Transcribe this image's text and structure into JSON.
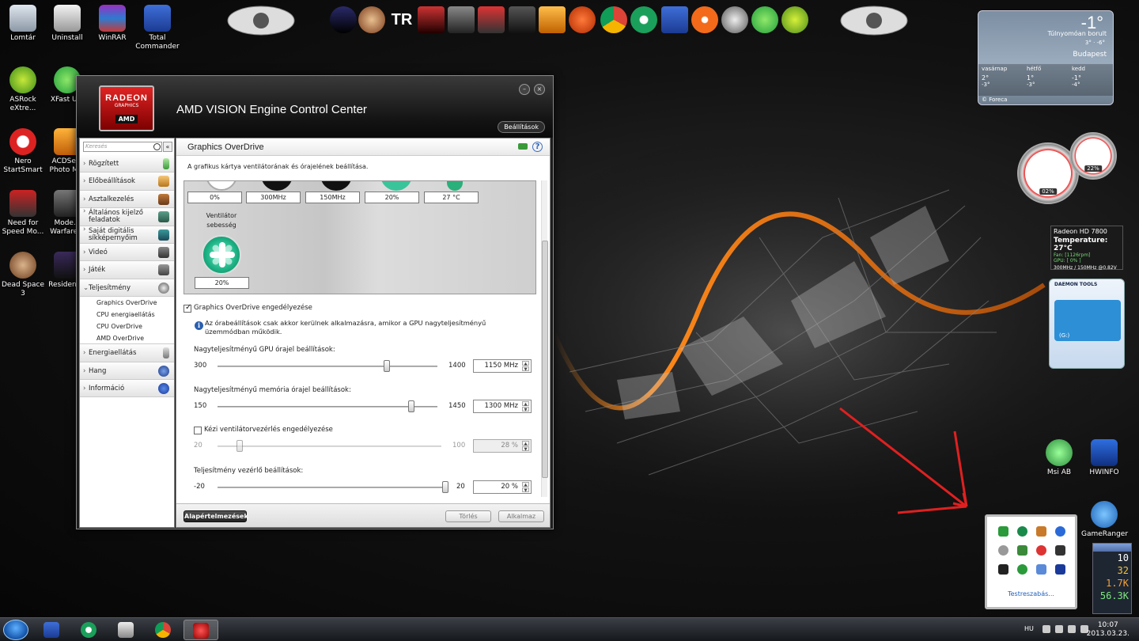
{
  "desktop": {
    "icons": [
      {
        "label": "Lomtár"
      },
      {
        "label": "Uninstall"
      },
      {
        "label": "WinRAR"
      },
      {
        "label": "Total Commander"
      },
      {
        "label": "ASRock eXtre..."
      },
      {
        "label": "XFast U..."
      },
      {
        "label": "Nero StartSmart"
      },
      {
        "label": "ACDSe... Photo M..."
      },
      {
        "label": "Need for Speed Mo..."
      },
      {
        "label": "Mode... Warfare..."
      },
      {
        "label": "Dead Space 3"
      },
      {
        "label": "Resident..."
      },
      {
        "label": "Msi AB"
      },
      {
        "label": "HWINFO"
      },
      {
        "label": "GameRanger"
      }
    ]
  },
  "dock": {
    "label_tr": "TR"
  },
  "weather": {
    "temperature": "-1°",
    "condition": "Túlnyomóan borult",
    "minmax": "3° · -6°",
    "city": "Budapest",
    "days": [
      {
        "name": "vasárnap",
        "hi": "2°",
        "lo": "-3°"
      },
      {
        "name": "hétfő",
        "hi": "1°",
        "lo": "-3°"
      },
      {
        "name": "kedd",
        "hi": "-1°",
        "lo": "-4°"
      }
    ],
    "brand": "© Foreca"
  },
  "gauges": {
    "cpu_label": "02%",
    "ram_label": "22%"
  },
  "ati_gadget": {
    "title": "Radeon HD 7800",
    "temperature_label": "Temperature:",
    "temperature": "27°C",
    "fan": "Fan: [1126rpm]",
    "gpu": "GPU: [ 0% ]",
    "clocks": "300MHz / 150MHz @0.82V"
  },
  "daemon": {
    "title": "DAEMON TOOLS",
    "drive": "(G:)"
  },
  "tray_popup": {
    "customize": "Testreszabás..."
  },
  "counters": [
    "10",
    "32",
    "1.7K",
    "56.3K"
  ],
  "taskbar": {
    "language": "HU",
    "time": "10:07",
    "date": "2013.03.23."
  },
  "amd": {
    "logo_radeon": "RADEON",
    "logo_graphics": "GRAPHICS",
    "logo_amd": "AMD",
    "title": "AMD VISION Engine Control Center",
    "preferences": "Beállítások",
    "search_placeholder": "Keresés",
    "collapse": "«",
    "nav": [
      {
        "label": "Rögzített"
      },
      {
        "label": "Előbeállítások"
      },
      {
        "label": "Asztalkezelés"
      },
      {
        "label": "Általános kijelző feladatok"
      },
      {
        "label": "Saját digitális síkképernyőim"
      },
      {
        "label": "Videó"
      },
      {
        "label": "Játék"
      },
      {
        "label": "Teljesítmény"
      }
    ],
    "sub": [
      {
        "label": "Graphics OverDrive"
      },
      {
        "label": "CPU energiaellátás"
      },
      {
        "label": "CPU OverDrive"
      },
      {
        "label": "AMD OverDrive"
      }
    ],
    "nav2": [
      {
        "label": "Energiaellátás"
      },
      {
        "label": "Hang"
      },
      {
        "label": "Információ"
      }
    ],
    "page_title": "Graphics OverDrive",
    "help": "?",
    "description": "A grafikus kártya ventilátorának és órajelének beállítása.",
    "values": [
      "0%",
      "300MHz",
      "150MHz",
      "20%",
      "27 °C"
    ],
    "fan_label": "Ventilátor sebesség",
    "fan_value": "20%",
    "enable_label": "Graphics OverDrive engedélyezése",
    "info_icon": "i",
    "note": "Az órabeállítások csak akkor kerülnek alkalmazásra, amikor a GPU nagyteljesítményű üzemmódban működik.",
    "gpu_clock": {
      "label": "Nagyteljesítményű GPU órajel beállítások:",
      "min": "300",
      "max": "1400",
      "value": "1150",
      "unit": "MHz",
      "fraction": 0.77
    },
    "mem_clock": {
      "label": "Nagyteljesítményű memória órajel beállítások:",
      "min": "150",
      "max": "1450",
      "value": "1300",
      "unit": "MHz",
      "fraction": 0.88
    },
    "manual_fan": {
      "label": "Kézi ventilátorvezérlés engedélyezése",
      "min": "20",
      "max": "100",
      "value": "28",
      "unit": "%",
      "fraction": 0.1
    },
    "power": {
      "label": "Teljesítmény vezérlő beállítások:",
      "min": "-20",
      "max": "20",
      "value": "20",
      "unit": "%",
      "fraction": 1.0
    },
    "btn_default": "Alapértelmezések",
    "btn_discard": "Törlés",
    "btn_apply": "Alkalmaz"
  }
}
